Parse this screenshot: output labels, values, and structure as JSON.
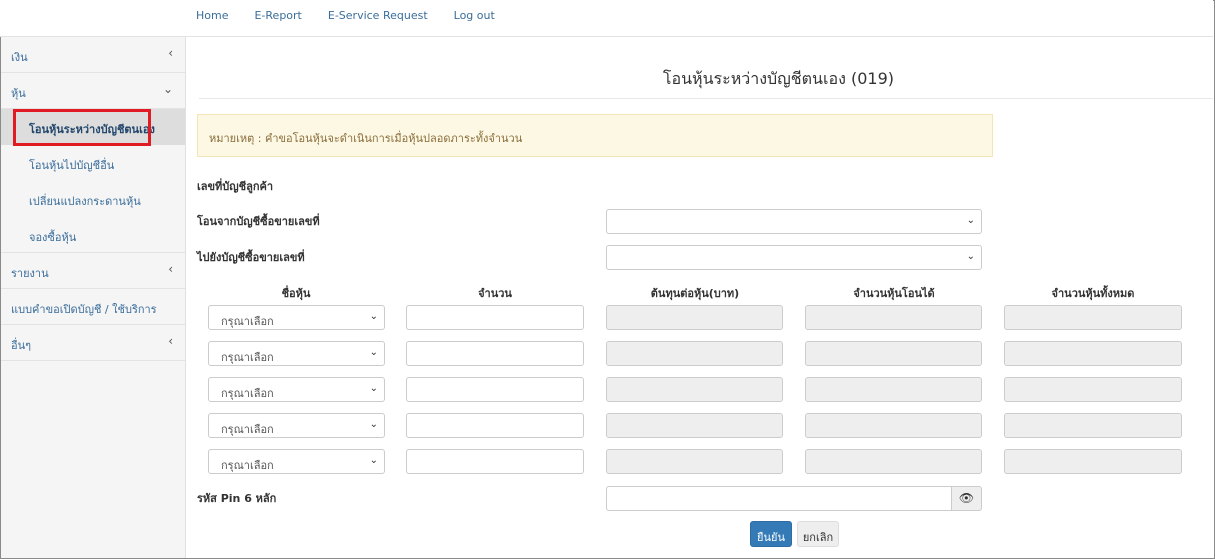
{
  "topnav": {
    "home": "Home",
    "ereport": "E-Report",
    "eservice": "E-Service Request",
    "logout": "Log out"
  },
  "sidebar": {
    "money": "เงิน",
    "stock": "หุ้น",
    "sub_transfer_own": "โอนหุ้นระหว่างบัญชีตนเอง",
    "sub_transfer_other": "โอนหุ้นไปบัญชีอื่น",
    "sub_change_board": "เปลี่ยนแปลงกระดานหุ้น",
    "sub_subscribe": "จองซื้อหุ้น",
    "report": "รายงาน",
    "forms": "แบบคำขอเปิดบัญชี / ใช้บริการ",
    "others": "อื่นๆ"
  },
  "page": {
    "title": "โอนหุ้นระหว่างบัญชีตนเอง (019)",
    "note": "หมายเหตุ : คำขอโอนหุ้นจะดำเนินการเมื่อหุ้นปลอดภาระทั้งจำนวน",
    "customer_account_label": "เลขที่บัญชีลูกค้า",
    "from_account_label": "โอนจากบัญชีซื้อขายเลขที่",
    "to_account_label": "ไปยังบัญชีซื้อขายเลขที่",
    "pin_label": "รหัส Pin 6 หลัก"
  },
  "table": {
    "headers": [
      "ชื่อหุ้น",
      "จำนวน",
      "ต้นทุนต่อหุ้น(บาท)",
      "จำนวนหุ้นโอนได้",
      "จำนวนหุ้นทั้งหมด"
    ],
    "select_placeholder": "กรุณาเลือก"
  },
  "buttons": {
    "confirm": "ยืนยัน",
    "cancel": "ยกเลิก"
  }
}
